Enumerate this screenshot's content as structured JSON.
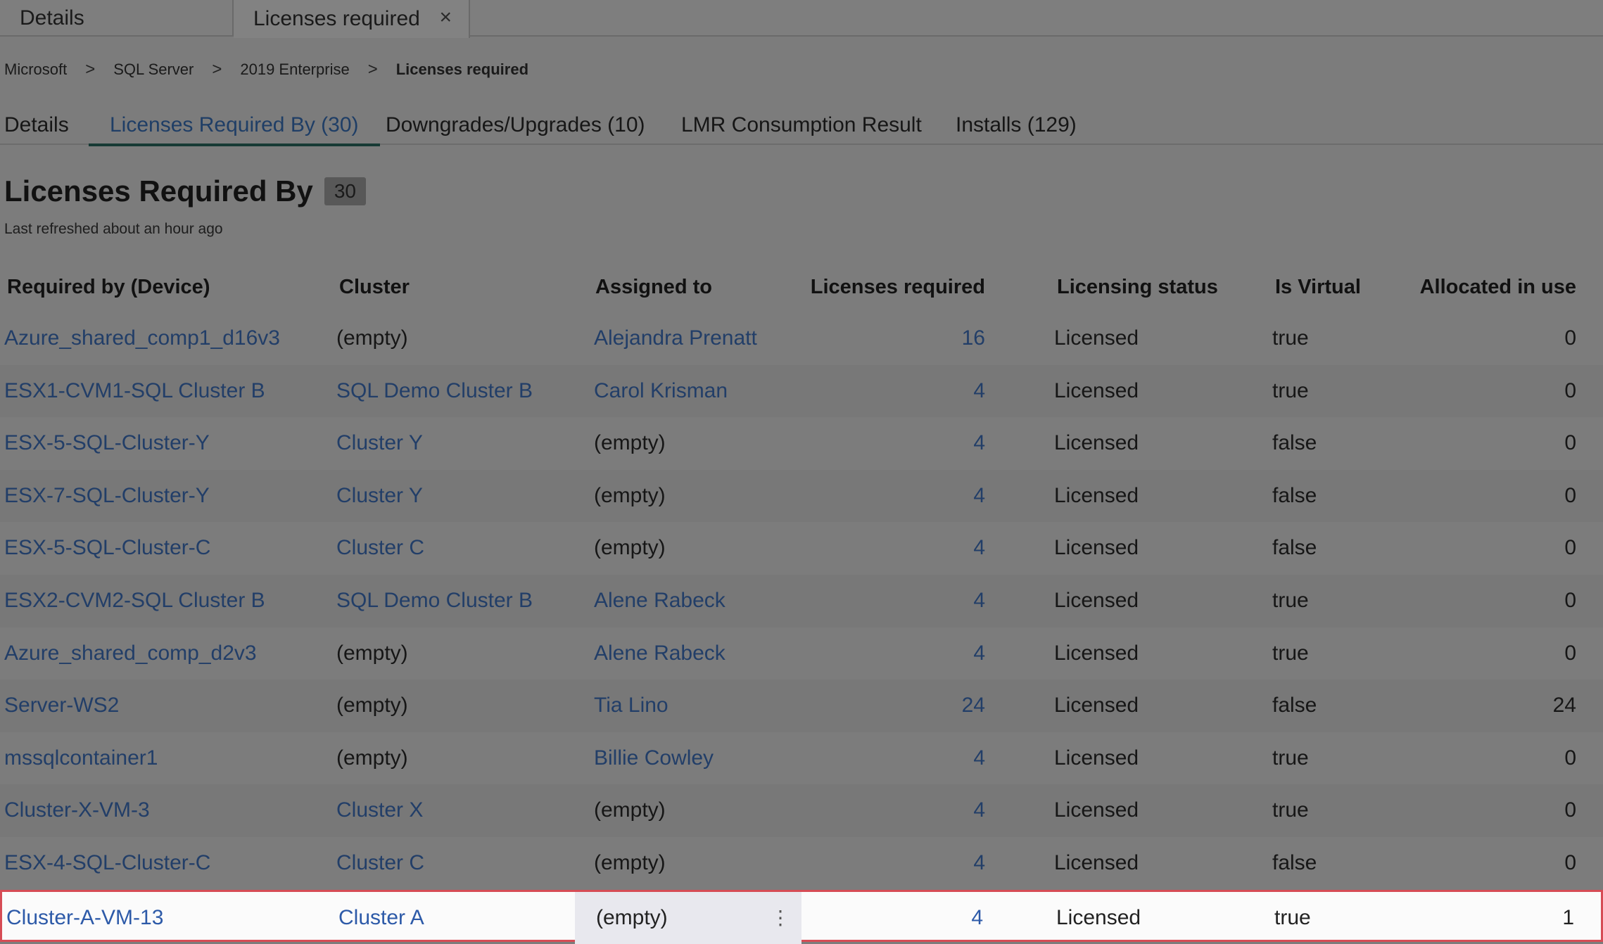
{
  "window_tabs": [
    {
      "label": "Details"
    },
    {
      "label": "Licenses required",
      "close_glyph": "×"
    }
  ],
  "breadcrumb": {
    "items": [
      "Microsoft",
      "SQL Server",
      "2019 Enterprise",
      "Licenses required"
    ],
    "separator": ">"
  },
  "subtabs": [
    {
      "label": "Details"
    },
    {
      "label": "Licenses Required By (30)"
    },
    {
      "label": "Downgrades/Upgrades (10)"
    },
    {
      "label": "LMR Consumption Result"
    },
    {
      "label": "Installs (129)"
    }
  ],
  "page": {
    "title": "Licenses Required By",
    "count": "30",
    "refreshed": "Last refreshed about an hour ago"
  },
  "table": {
    "headers": [
      "Required by (Device)",
      "Cluster",
      "Assigned to",
      "Licenses required",
      "Licensing status",
      "Is Virtual",
      "Allocated in use"
    ],
    "rows": [
      {
        "device": "Azure_shared_comp1_d16v3",
        "cluster": "(empty)",
        "assigned": "Alejandra Prenatt",
        "required": "16",
        "status": "Licensed",
        "virtual": "true",
        "allocated": "0"
      },
      {
        "device": "ESX1-CVM1-SQL Cluster B",
        "cluster": "SQL Demo Cluster B",
        "assigned": "Carol Krisman",
        "required": "4",
        "status": "Licensed",
        "virtual": "true",
        "allocated": "0"
      },
      {
        "device": "ESX-5-SQL-Cluster-Y",
        "cluster": "Cluster Y",
        "assigned": "(empty)",
        "required": "4",
        "status": "Licensed",
        "virtual": "false",
        "allocated": "0"
      },
      {
        "device": "ESX-7-SQL-Cluster-Y",
        "cluster": "Cluster Y",
        "assigned": "(empty)",
        "required": "4",
        "status": "Licensed",
        "virtual": "false",
        "allocated": "0"
      },
      {
        "device": "ESX-5-SQL-Cluster-C",
        "cluster": "Cluster C",
        "assigned": "(empty)",
        "required": "4",
        "status": "Licensed",
        "virtual": "false",
        "allocated": "0"
      },
      {
        "device": "ESX2-CVM2-SQL Cluster B",
        "cluster": "SQL Demo Cluster B",
        "assigned": "Alene Rabeck",
        "required": "4",
        "status": "Licensed",
        "virtual": "true",
        "allocated": "0"
      },
      {
        "device": "Azure_shared_comp_d2v3",
        "cluster": "(empty)",
        "assigned": "Alene Rabeck",
        "required": "4",
        "status": "Licensed",
        "virtual": "true",
        "allocated": "0"
      },
      {
        "device": "Server-WS2",
        "cluster": "(empty)",
        "assigned": "Tia Lino",
        "required": "24",
        "status": "Licensed",
        "virtual": "false",
        "allocated": "24"
      },
      {
        "device": "mssqlcontainer1",
        "cluster": "(empty)",
        "assigned": "Billie Cowley",
        "required": "4",
        "status": "Licensed",
        "virtual": "true",
        "allocated": "0"
      },
      {
        "device": "Cluster-X-VM-3",
        "cluster": "Cluster X",
        "assigned": "(empty)",
        "required": "4",
        "status": "Licensed",
        "virtual": "true",
        "allocated": "0"
      },
      {
        "device": "ESX-4-SQL-Cluster-C",
        "cluster": "Cluster C",
        "assigned": "(empty)",
        "required": "4",
        "status": "Licensed",
        "virtual": "false",
        "allocated": "0"
      },
      {
        "device": "Cluster-A-VM-13",
        "cluster": "Cluster A",
        "assigned": "(empty)",
        "required": "4",
        "status": "Licensed",
        "virtual": "true",
        "allocated": "1",
        "kebab": "⋮"
      }
    ]
  },
  "colors": {
    "link": "#2d5aa8",
    "selected_border": "#d64c55",
    "active_tab_underline": "#173a35"
  }
}
